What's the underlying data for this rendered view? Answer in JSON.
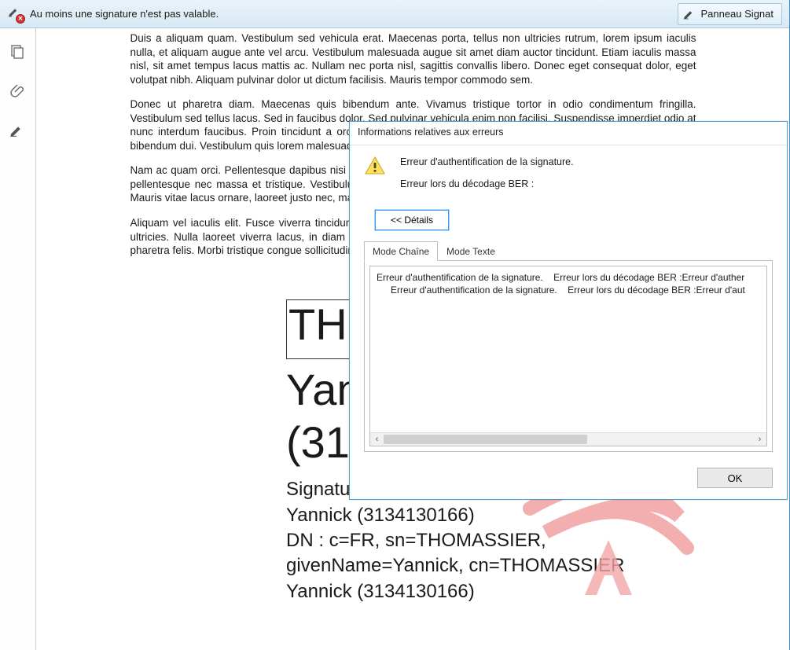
{
  "notif": {
    "message": "Au moins une signature n'est pas valable.",
    "panel_button": "Panneau Signat"
  },
  "document": {
    "p1": "Duis a aliquam quam. Vestibulum sed vehicula erat. Maecenas porta, tellus non ultricies rutrum, lorem ipsum iaculis nulla, et aliquam augue ante vel arcu. Vestibulum malesuada augue sit amet diam auctor tincidunt. Etiam iaculis massa nisl, sit amet tempus lacus mattis ac. Nullam nec porta nisl, sagittis convallis libero. Donec eget consequat dolor, eget volutpat nibh. Aliquam pulvinar dolor ut dictum facilisis. Mauris tempor commodo sem.",
    "p2": "Donec ut pharetra diam. Maecenas quis bibendum ante. Vivamus tristique tortor in odio condimentum fringilla. Vestibulum sed tellus lacus. Sed in faucibus dolor. Sed pulvinar vehicula enim non facilisi. Suspendisse imperdiet odio at nunc interdum faucibus. Proin tincidunt a orci ac pretium. Donec amet massa viverra, consectetur metus interdum, bibendum dui. Vestibulum quis lorem malesuada venenatis. Aliquam accumsan augue …",
    "p3": "Nam ac quam orci. Pellentesque dapibus nisi ut odio accumsan, quis elementum natoque turpis suscipit porttitor. Proin pellentesque nec massa et tristique. Vestibulum vulputate sapien massa mollis. Aenean luctus non leo nec placerat. Mauris vitae lacus ornare, laoreet justo nec, malesuada feugiat.",
    "p4": "Aliquam vel iaculis elit. Fusce viverra tincidunt justo, nec fermentum erat. Pellentesque ultrices feugiat faucibus urna ultricies. Nulla laoreet viverra lacus, in diam et dolor blandit sodales nec a mi. Suspendisse non sodales lorem, eu pharetra felis. Morbi tristique congue sollicitudin. Nunc convallis tristique nisl, vitae elementum velit vehicula urna."
  },
  "signature": {
    "box": "THO",
    "big1": "Yann",
    "big2": "(313",
    "line1": "Signature numérique de THOMASSIER",
    "line2": "Yannick (3134130166)",
    "line3": "DN : c=FR, sn=THOMASSIER,",
    "line4": "givenName=Yannick, cn=THOMASSIER",
    "line5": "Yannick (3134130166)"
  },
  "dialog": {
    "title": "Informations relatives aux erreurs",
    "err1": "Erreur d'authentification de la signature.",
    "err2": "Erreur lors du décodage BER :",
    "details_btn": "<< Détails",
    "tabs": {
      "chain": "Mode Chaîne",
      "text": "Mode Texte"
    },
    "list": {
      "l1a": "Erreur d'authentification de la signature.",
      "l1b": "Erreur lors du décodage BER :Erreur d'auther",
      "l2a": "Erreur d'authentification de la signature.",
      "l2b": "Erreur lors du décodage BER :Erreur d'aut"
    },
    "ok": "OK"
  }
}
